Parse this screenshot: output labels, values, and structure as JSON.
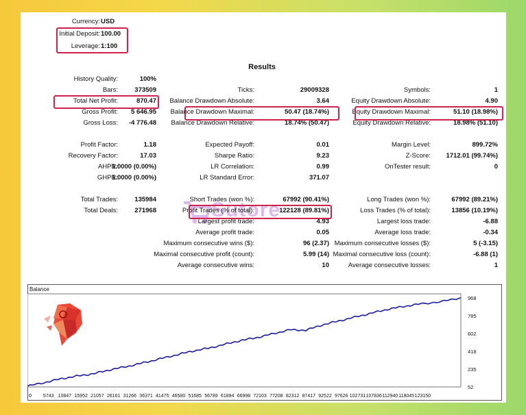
{
  "header": {
    "currency_label": "Currency:",
    "currency_value": "USD",
    "deposit_label": "Initial Deposit:",
    "deposit_value": "100.00",
    "leverage_label": "Leverage:",
    "leverage_value": "1:100"
  },
  "results_title": "Results",
  "col1": [
    {
      "label": "History Quality:",
      "value": "100%"
    },
    {
      "label": "Bars:",
      "value": "373509"
    },
    {
      "label": "Total Net Profit:",
      "value": "870.47"
    },
    {
      "label": "Gross Profit:",
      "value": "5 646.95"
    },
    {
      "label": "Gross Loss:",
      "value": "-4 776.48"
    },
    {
      "label": "Profit Factor:",
      "value": "1.18"
    },
    {
      "label": "Recovery Factor:",
      "value": "17.03"
    },
    {
      "label": "AHPR:",
      "value": "1.0000 (0.00%)"
    },
    {
      "label": "GHPR:",
      "value": "1.0000 (0.00%)"
    },
    {
      "label": "Total Trades:",
      "value": "135984"
    },
    {
      "label": "Total Deals:",
      "value": "271968"
    }
  ],
  "col2": [
    {
      "label": "Ticks:",
      "value": "29009328"
    },
    {
      "label": "Balance Drawdown Absolute:",
      "value": "3.64"
    },
    {
      "label": "Balance Drawdown Maximal:",
      "value": "50.47 (18.74%)"
    },
    {
      "label": "Balance Drawdown Relative:",
      "value": "18.74% (50.47)"
    },
    {
      "label": "Expected Payoff:",
      "value": "0.01"
    },
    {
      "label": "Sharpe Ratio:",
      "value": "9.23"
    },
    {
      "label": "LR Correlation:",
      "value": "0.99"
    },
    {
      "label": "LR Standard Error:",
      "value": "371.07"
    },
    {
      "label": "Short Trades (won %):",
      "value": "67992 (90.41%)"
    },
    {
      "label": "Profit Trades (% of total):",
      "value": "122128 (89.81%)"
    },
    {
      "label": "Largest profit trade:",
      "value": "4.93"
    },
    {
      "label": "Average profit trade:",
      "value": "0.05"
    },
    {
      "label": "Maximum consecutive wins ($):",
      "value": "96 (2.37)"
    },
    {
      "label": "Maximal consecutive profit (count):",
      "value": "5.99 (14)"
    },
    {
      "label": "Average consecutive wins:",
      "value": "10"
    }
  ],
  "col3": [
    {
      "label": "Symbols:",
      "value": "1"
    },
    {
      "label": "Equity Drawdown Absolute:",
      "value": "4.90"
    },
    {
      "label": "Equity Drawdown Maximal:",
      "value": "51.10 (18.98%)"
    },
    {
      "label": "Equity Drawdown Relative:",
      "value": "18.98% (51.10)"
    },
    {
      "label": "Margin Level:",
      "value": "899.72%"
    },
    {
      "label": "Z-Score:",
      "value": "1712.01 (99.74%)"
    },
    {
      "label": "OnTester result:",
      "value": "0"
    },
    {
      "label": "Long Trades (won %):",
      "value": "67992 (89.21%)"
    },
    {
      "label": "Loss Trades (% of total):",
      "value": "13856 (10.19%)"
    },
    {
      "label": "Largest loss trade:",
      "value": "-6.88"
    },
    {
      "label": "Average loss trade:",
      "value": "-0.34"
    },
    {
      "label": "Maximum consecutive losses ($):",
      "value": "5 (-3.15)"
    },
    {
      "label": "Maximal consecutive loss (count):",
      "value": "-6.88 (1)"
    },
    {
      "label": "Average consecutive losses:",
      "value": "1"
    }
  ],
  "watermark_text": "Sutore",
  "colors": {
    "highlight": "#d0204c",
    "balance_line": "#1a1aa0"
  },
  "chart_data": {
    "type": "line",
    "title": "Balance",
    "x_ticks": [
      "0",
      "5743",
      "10847",
      "15952",
      "21057",
      "26161",
      "31266",
      "36371",
      "41475",
      "46580",
      "51685",
      "56789",
      "61894",
      "66998",
      "72103",
      "77208",
      "82312",
      "87417",
      "92522",
      "97626",
      "102731",
      "107836",
      "112940",
      "118045",
      "123150"
    ],
    "y_ticks": [
      "968",
      "785",
      "602",
      "418",
      "235",
      "52"
    ],
    "ylim": [
      52,
      1010
    ],
    "xlim": [
      0,
      135984
    ],
    "series": [
      {
        "x": [
          0,
          5743,
          10847,
          15952,
          21057,
          26161,
          31266,
          36371,
          41475,
          46580,
          51685,
          56789,
          61894,
          66998,
          72103,
          77208,
          82312,
          87417,
          92522,
          97626,
          102731,
          107836,
          112940,
          118045,
          123150,
          130000,
          135984
        ],
        "y": [
          60,
          100,
          138,
          165,
          190,
          230,
          262,
          300,
          340,
          380,
          420,
          450,
          490,
          530,
          560,
          600,
          640,
          635,
          690,
          730,
          770,
          810,
          850,
          880,
          905,
          930,
          970
        ]
      }
    ]
  }
}
